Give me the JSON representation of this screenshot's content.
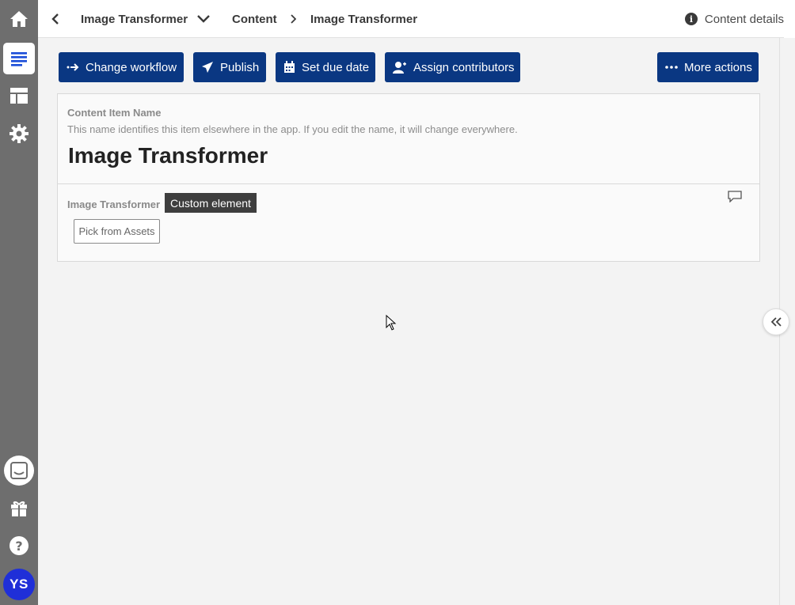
{
  "topbar": {
    "back_label": "‹",
    "title": "Image Transformer",
    "breadcrumb_root": "Content",
    "breadcrumb_current": "Image Transformer",
    "content_details": "Content details"
  },
  "actions": {
    "change_workflow": "Change workflow",
    "publish": "Publish",
    "set_due_date": "Set due date",
    "assign_contributors": "Assign contributors",
    "more_actions": "More actions"
  },
  "item": {
    "name_label": "Content Item Name",
    "name_hint": "This name identifies this item elsewhere in the app. If you edit the name, it will change everywhere.",
    "name_value": "Image Transformer"
  },
  "element": {
    "label": "Image Transformer",
    "tag": "Custom element",
    "pick_button": "Pick from Assets"
  },
  "user": {
    "initials": "YS"
  },
  "colors": {
    "primary": "#0a3782",
    "rail": "#6e6e6e",
    "avatar": "#1f2fd8",
    "active_icon": "#1a4dd8"
  },
  "icons": [
    "home-icon",
    "content-list-icon",
    "layout-icon",
    "gear-icon",
    "chat-icon",
    "gift-icon",
    "help-icon",
    "info-icon",
    "comment-icon",
    "double-chevron-left-icon"
  ]
}
